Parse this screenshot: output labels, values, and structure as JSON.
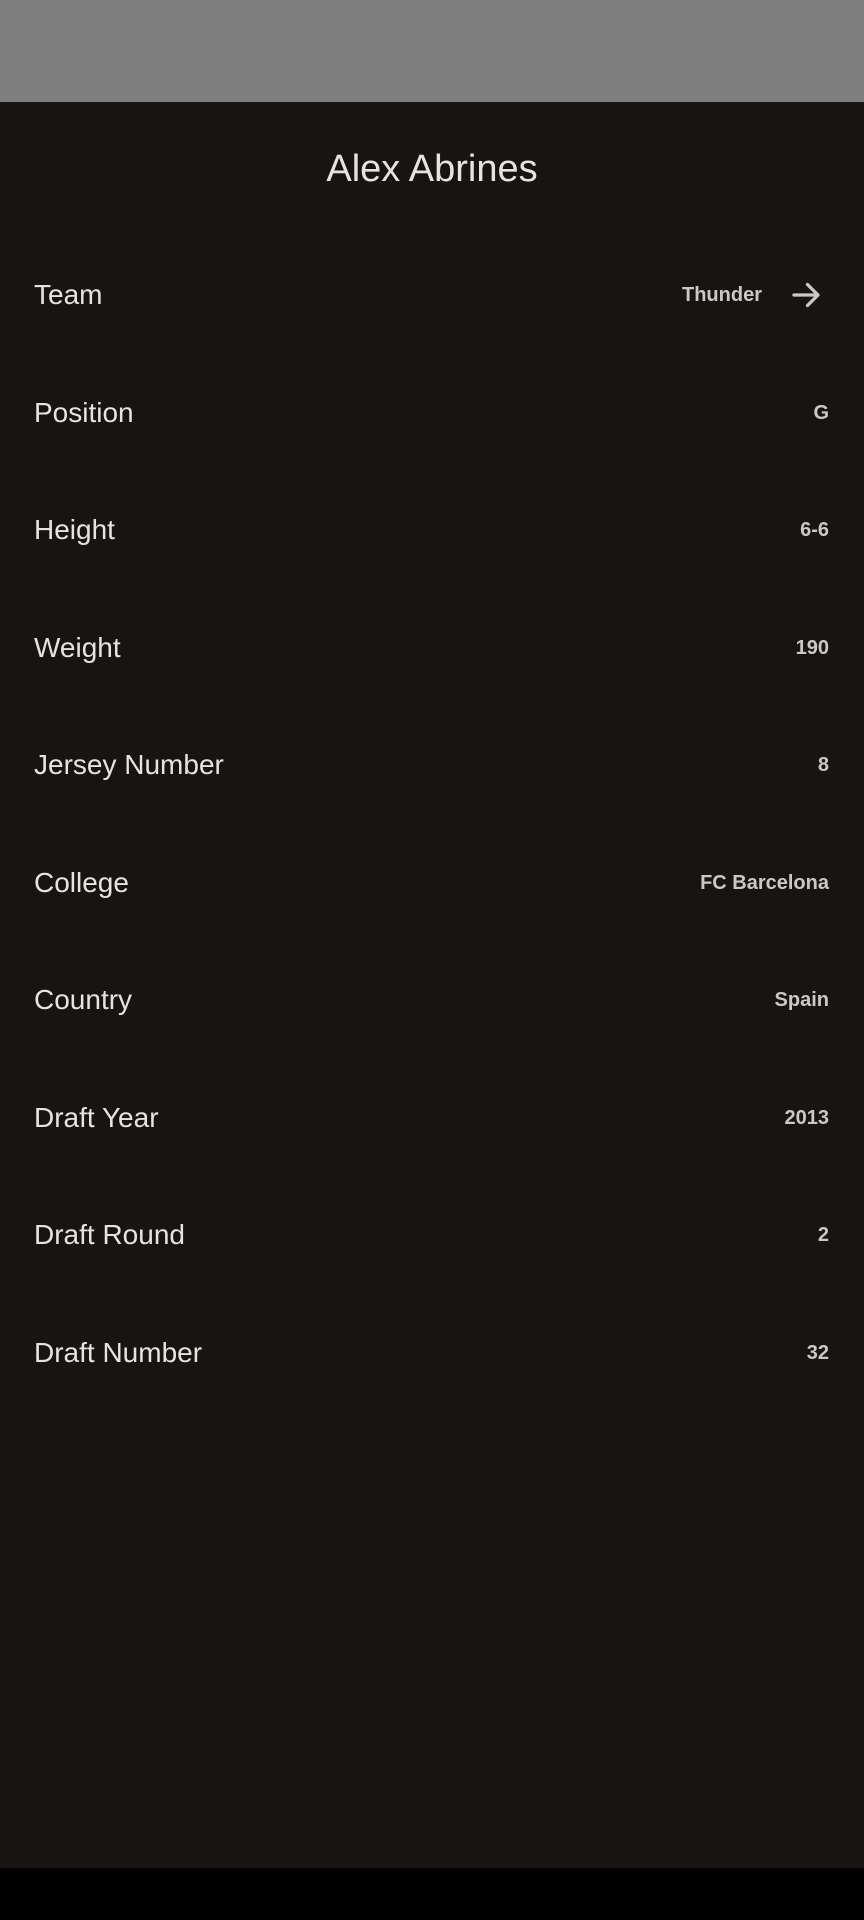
{
  "page": {
    "title": "Alex Abrines"
  },
  "details": [
    {
      "label": "Team",
      "value": "Thunder",
      "has_link": true,
      "icon": "arrow-right-icon"
    },
    {
      "label": "Position",
      "value": "G"
    },
    {
      "label": "Height",
      "value": "6-6"
    },
    {
      "label": "Weight",
      "value": "190"
    },
    {
      "label": "Jersey Number",
      "value": "8"
    },
    {
      "label": "College",
      "value": "FC Barcelona"
    },
    {
      "label": "Country",
      "value": "Spain"
    },
    {
      "label": "Draft Year",
      "value": "2013"
    },
    {
      "label": "Draft Round",
      "value": "2"
    },
    {
      "label": "Draft Number",
      "value": "32"
    }
  ],
  "colors": {
    "background": "#181414",
    "status_bar": "#7f7f7f",
    "text_primary": "#e8e3e3",
    "text_secondary": "#cdc8c8"
  }
}
